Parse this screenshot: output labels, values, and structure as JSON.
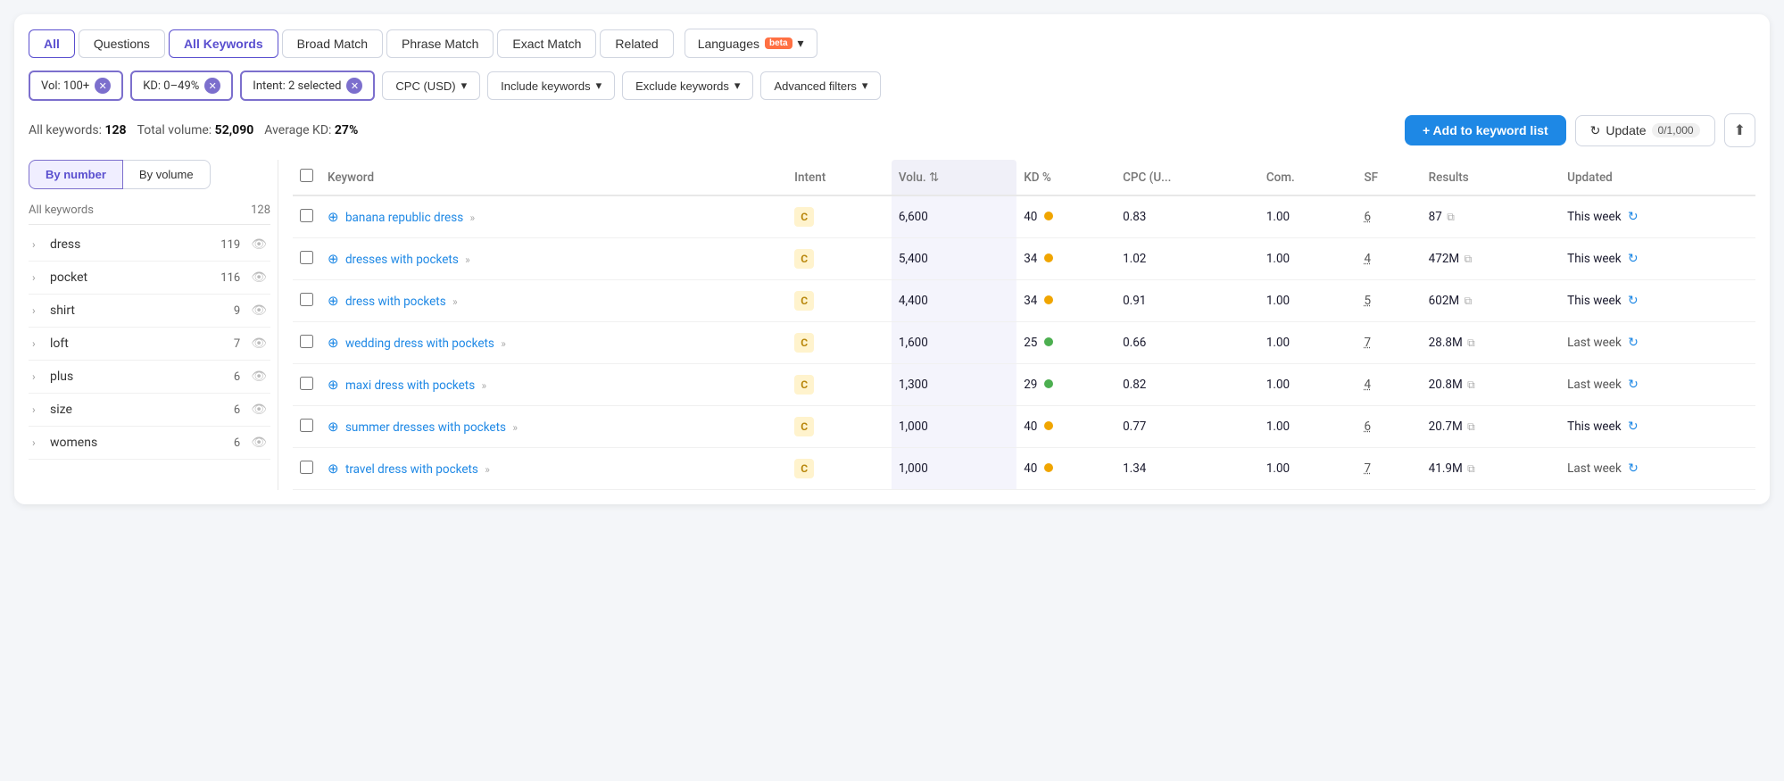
{
  "tabs": [
    {
      "label": "All",
      "active": true
    },
    {
      "label": "Questions",
      "active": false
    },
    {
      "label": "All Keywords",
      "active": true
    },
    {
      "label": "Broad Match",
      "active": false
    },
    {
      "label": "Phrase Match",
      "active": false
    },
    {
      "label": "Exact Match",
      "active": false
    },
    {
      "label": "Related",
      "active": false
    }
  ],
  "languages_btn": "Languages",
  "beta_label": "beta",
  "filters": [
    {
      "label": "Vol: 100+",
      "id": "vol-filter"
    },
    {
      "label": "KD: 0–49%",
      "id": "kd-filter"
    },
    {
      "label": "Intent: 2 selected",
      "id": "intent-filter"
    }
  ],
  "dropdown_filters": [
    {
      "label": "CPC (USD)",
      "id": "cpc-filter"
    },
    {
      "label": "Include keywords",
      "id": "include-filter"
    },
    {
      "label": "Exclude keywords",
      "id": "exclude-filter"
    },
    {
      "label": "Advanced filters",
      "id": "advanced-filter"
    }
  ],
  "stats": {
    "all_keywords_label": "All keywords:",
    "all_keywords_value": "128",
    "total_volume_label": "Total volume:",
    "total_volume_value": "52,090",
    "avg_kd_label": "Average KD:",
    "avg_kd_value": "27%"
  },
  "actions": {
    "add_label": "+ Add to keyword list",
    "update_label": "Update",
    "update_counter": "0/1,000"
  },
  "sort_buttons": [
    {
      "label": "By number",
      "active": true
    },
    {
      "label": "By volume",
      "active": false
    }
  ],
  "sidebar": {
    "header_label": "All keywords",
    "header_count": "128",
    "items": [
      {
        "label": "dress",
        "count": "119"
      },
      {
        "label": "pocket",
        "count": "116"
      },
      {
        "label": "shirt",
        "count": "9"
      },
      {
        "label": "loft",
        "count": "7"
      },
      {
        "label": "plus",
        "count": "6"
      },
      {
        "label": "size",
        "count": "6"
      },
      {
        "label": "womens",
        "count": "6"
      }
    ]
  },
  "table": {
    "columns": [
      {
        "label": "Keyword",
        "id": "keyword"
      },
      {
        "label": "Intent",
        "id": "intent"
      },
      {
        "label": "Volu.",
        "id": "volume",
        "sortable": true
      },
      {
        "label": "KD %",
        "id": "kd"
      },
      {
        "label": "CPC (U...",
        "id": "cpc"
      },
      {
        "label": "Com.",
        "id": "com"
      },
      {
        "label": "SF",
        "id": "sf"
      },
      {
        "label": "Results",
        "id": "results"
      },
      {
        "label": "Updated",
        "id": "updated"
      }
    ],
    "rows": [
      {
        "keyword": "banana republic dress",
        "intent": "C",
        "volume": "6,600",
        "kd": "40",
        "kd_color": "yellow",
        "cpc": "0.83",
        "com": "1.00",
        "sf": "6",
        "results": "87",
        "updated": "This week"
      },
      {
        "keyword": "dresses with pockets",
        "intent": "C",
        "volume": "5,400",
        "kd": "34",
        "kd_color": "yellow",
        "cpc": "1.02",
        "com": "1.00",
        "sf": "4",
        "results": "472M",
        "updated": "This week"
      },
      {
        "keyword": "dress with pockets",
        "intent": "C",
        "volume": "4,400",
        "kd": "34",
        "kd_color": "yellow",
        "cpc": "0.91",
        "com": "1.00",
        "sf": "5",
        "results": "602M",
        "updated": "This week"
      },
      {
        "keyword": "wedding dress with pockets",
        "intent": "C",
        "volume": "1,600",
        "kd": "25",
        "kd_color": "green",
        "cpc": "0.66",
        "com": "1.00",
        "sf": "7",
        "results": "28.8M",
        "updated": "Last week"
      },
      {
        "keyword": "maxi dress with pockets",
        "intent": "C",
        "volume": "1,300",
        "kd": "29",
        "kd_color": "green",
        "cpc": "0.82",
        "com": "1.00",
        "sf": "4",
        "results": "20.8M",
        "updated": "Last week"
      },
      {
        "keyword": "summer dresses with pockets",
        "intent": "C",
        "volume": "1,000",
        "kd": "40",
        "kd_color": "yellow",
        "cpc": "0.77",
        "com": "1.00",
        "sf": "6",
        "results": "20.7M",
        "updated": "This week"
      },
      {
        "keyword": "travel dress with pockets",
        "intent": "C",
        "volume": "1,000",
        "kd": "40",
        "kd_color": "yellow",
        "cpc": "1.34",
        "com": "1.00",
        "sf": "7",
        "results": "41.9M",
        "updated": "Last week"
      }
    ]
  }
}
